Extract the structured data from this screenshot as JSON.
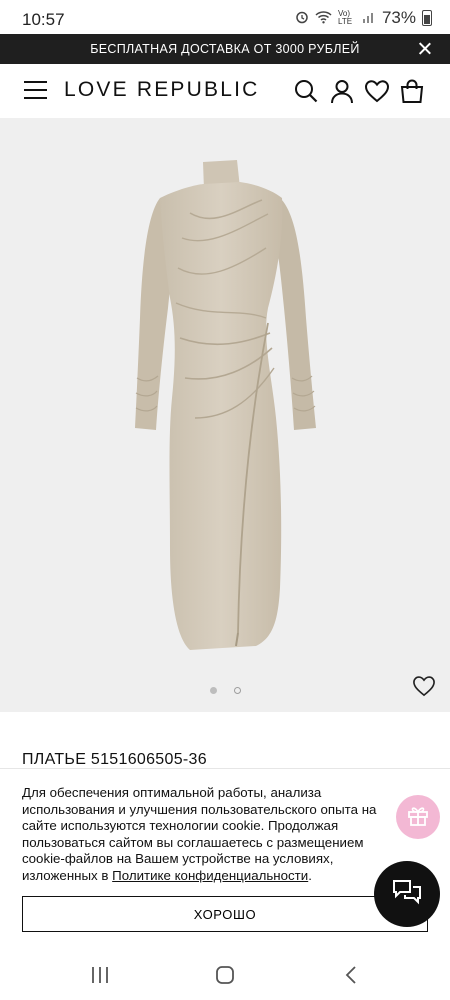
{
  "status_bar": {
    "time": "10:57",
    "network": "Vo) LTE",
    "battery": "73%"
  },
  "promo": {
    "text": "БЕСПЛАТНАЯ ДОСТАВКА ОТ 3000 РУБЛЕЙ"
  },
  "header": {
    "logo": "LOVE REPUBLIC",
    "icons": [
      "menu-icon",
      "search-icon",
      "user-icon",
      "heart-icon",
      "bag-icon"
    ]
  },
  "gallery": {
    "slide_count": 2,
    "active_slide": 1
  },
  "product": {
    "title": "ПЛАТЬЕ 5151606505-36",
    "image_color": "#cfc5b4"
  },
  "cookie": {
    "text": "Для обеспечения оптимальной работы, анализа использования и улучшения пользовательского опыта на сайте используются технологии cookie. Продолжая пользоваться сайтом вы соглашаетесь с размещением cookie-файлов на Вашем устройстве на условиях, изложенных в ",
    "link_text": "Политике конфиденциальности",
    "after_link": ".",
    "button_label": "ХОРОШО"
  },
  "floating": {
    "gift_color": "#f3b8d4",
    "chat_color": "#111111"
  }
}
